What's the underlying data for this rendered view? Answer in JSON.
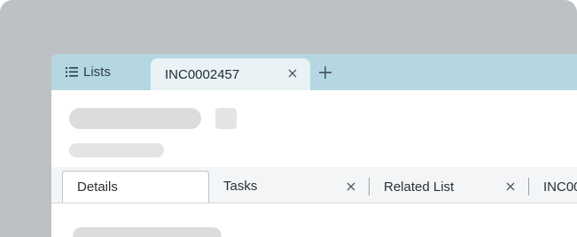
{
  "app_tabs": {
    "lists_label": "Lists",
    "record_tab_label": "INC0002457"
  },
  "record_tabs": [
    {
      "label": "Details"
    },
    {
      "label": "Tasks"
    },
    {
      "label": "Related List"
    },
    {
      "label": "INC00"
    }
  ],
  "icons": {
    "lists": "list-icon",
    "close": "close-icon",
    "add": "plus-icon"
  },
  "colors": {
    "tabbar": "#b4d7e1",
    "active_tab": "#e9f3f6",
    "background": "#bdc1c4"
  }
}
